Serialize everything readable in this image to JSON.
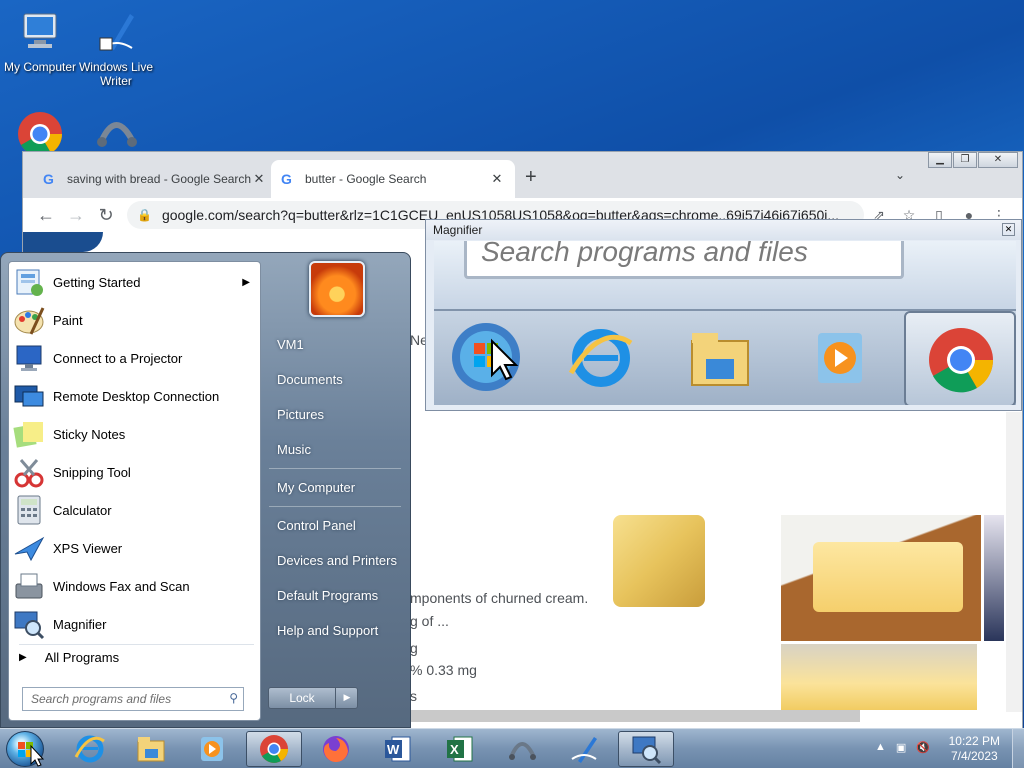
{
  "desktop": {
    "icons": [
      {
        "label": "My Computer",
        "icon": "computer-icon"
      },
      {
        "label": "Windows Live Writer",
        "icon": "pen-icon"
      },
      {
        "label": "Google Chrome",
        "icon": "chrome-icon"
      },
      {
        "label": "",
        "icon": "network-icon"
      }
    ]
  },
  "chrome": {
    "tabs": [
      {
        "title": "saving with bread - Google Search",
        "active": false
      },
      {
        "title": "butter - Google Search",
        "active": true
      }
    ],
    "close_glyph": "✕",
    "new_tab_glyph": "+",
    "url": "google.com/search?q=butter&rlz=1C1GCEU_enUS1058US1058&oq=butter&aqs=chrome..69i57j46i67j650i...",
    "content": {
      "partial_word": "Ne",
      "snippets": [
        "mponents of churned cream.",
        "g of ...",
        "g",
        "% 0.33 mg",
        "s"
      ]
    }
  },
  "magnifier": {
    "title": "Magnifier",
    "search_text": "Search programs and files"
  },
  "startmenu": {
    "left_items": [
      {
        "label": "Getting Started",
        "icon": "getting-started-icon",
        "has_submenu": true
      },
      {
        "label": "Paint",
        "icon": "paint-icon"
      },
      {
        "label": "Connect to a Projector",
        "icon": "projector-icon"
      },
      {
        "label": "Remote Desktop Connection",
        "icon": "remote-desktop-icon"
      },
      {
        "label": "Sticky Notes",
        "icon": "sticky-notes-icon"
      },
      {
        "label": "Snipping Tool",
        "icon": "snipping-tool-icon"
      },
      {
        "label": "Calculator",
        "icon": "calculator-icon"
      },
      {
        "label": "XPS Viewer",
        "icon": "xps-viewer-icon"
      },
      {
        "label": "Windows Fax and Scan",
        "icon": "fax-icon"
      },
      {
        "label": "Magnifier",
        "icon": "magnifier-icon"
      }
    ],
    "all_programs": "All Programs",
    "search_placeholder": "Search programs and files",
    "right_items": [
      "VM1",
      "Documents",
      "Pictures",
      "Music",
      "My Computer",
      "Control Panel",
      "Devices and Printers",
      "Default Programs",
      "Help and Support"
    ],
    "lock_label": "Lock"
  },
  "taskbar": {
    "apps": [
      "ie-icon",
      "explorer-icon",
      "media-player-icon",
      "chrome-icon",
      "firefox-icon",
      "word-icon",
      "excel-icon",
      "network-icon",
      "writer-icon",
      "magnifier-icon"
    ],
    "time": "10:22 PM",
    "date": "7/4/2023"
  }
}
